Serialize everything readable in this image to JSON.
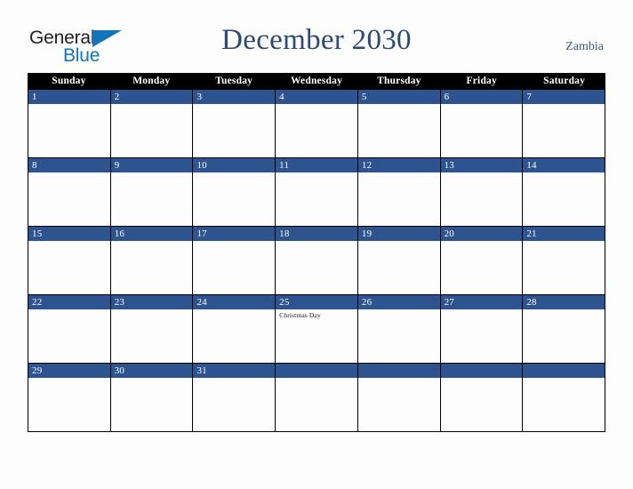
{
  "brand": {
    "name_part1": "General",
    "name_part2": "Blue",
    "triangle_color": "#1275bc",
    "text_color": "#231f20"
  },
  "header": {
    "title": "December 2030",
    "country": "Zambia",
    "title_color": "#2c4a73",
    "country_color": "#40577d"
  },
  "calendar": {
    "month": "December",
    "year": "2030",
    "accent_color": "#2e5490",
    "header_bg": "#000000",
    "weekdays": [
      "Sunday",
      "Monday",
      "Tuesday",
      "Wednesday",
      "Thursday",
      "Friday",
      "Saturday"
    ],
    "weeks": [
      [
        {
          "day": "1",
          "events": []
        },
        {
          "day": "2",
          "events": []
        },
        {
          "day": "3",
          "events": []
        },
        {
          "day": "4",
          "events": []
        },
        {
          "day": "5",
          "events": []
        },
        {
          "day": "6",
          "events": []
        },
        {
          "day": "7",
          "events": []
        }
      ],
      [
        {
          "day": "8",
          "events": []
        },
        {
          "day": "9",
          "events": []
        },
        {
          "day": "10",
          "events": []
        },
        {
          "day": "11",
          "events": []
        },
        {
          "day": "12",
          "events": []
        },
        {
          "day": "13",
          "events": []
        },
        {
          "day": "14",
          "events": []
        }
      ],
      [
        {
          "day": "15",
          "events": []
        },
        {
          "day": "16",
          "events": []
        },
        {
          "day": "17",
          "events": []
        },
        {
          "day": "18",
          "events": []
        },
        {
          "day": "19",
          "events": []
        },
        {
          "day": "20",
          "events": []
        },
        {
          "day": "21",
          "events": []
        }
      ],
      [
        {
          "day": "22",
          "events": []
        },
        {
          "day": "23",
          "events": []
        },
        {
          "day": "24",
          "events": []
        },
        {
          "day": "25",
          "events": [
            "Christmas Day"
          ]
        },
        {
          "day": "26",
          "events": []
        },
        {
          "day": "27",
          "events": []
        },
        {
          "day": "28",
          "events": []
        }
      ],
      [
        {
          "day": "29",
          "events": []
        },
        {
          "day": "30",
          "events": []
        },
        {
          "day": "31",
          "events": []
        },
        {
          "day": "",
          "events": []
        },
        {
          "day": "",
          "events": []
        },
        {
          "day": "",
          "events": []
        },
        {
          "day": "",
          "events": []
        }
      ]
    ]
  }
}
